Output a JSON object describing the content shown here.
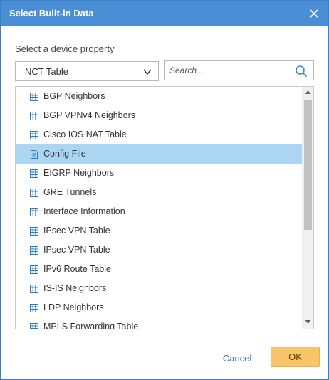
{
  "window": {
    "title": "Select Built-in Data"
  },
  "form": {
    "prompt": "Select a device property",
    "property_select": {
      "value": "NCT Table"
    },
    "search": {
      "placeholder": "Search...",
      "value": ""
    }
  },
  "list": {
    "items": [
      {
        "label": "BGP Neighbors",
        "icon": "table-icon",
        "selected": false
      },
      {
        "label": "BGP VPNv4 Neighbors",
        "icon": "table-icon",
        "selected": false
      },
      {
        "label": "Cisco IOS NAT Table",
        "icon": "table-icon",
        "selected": false
      },
      {
        "label": "Config File",
        "icon": "file-icon",
        "selected": true
      },
      {
        "label": "EIGRP Neighbors",
        "icon": "table-icon",
        "selected": false
      },
      {
        "label": "GRE Tunnels",
        "icon": "table-icon",
        "selected": false
      },
      {
        "label": "Interface Information",
        "icon": "table-icon",
        "selected": false
      },
      {
        "label": "IPsec VPN Table",
        "icon": "table-icon",
        "selected": false
      },
      {
        "label": "IPsec VPN Table",
        "icon": "table-icon",
        "selected": false
      },
      {
        "label": "IPv6 Route Table",
        "icon": "table-icon",
        "selected": false
      },
      {
        "label": "IS-IS Neighbors",
        "icon": "table-icon",
        "selected": false
      },
      {
        "label": "LDP Neighbors",
        "icon": "table-icon",
        "selected": false
      },
      {
        "label": "MPLS Forwarding Table",
        "icon": "table-icon",
        "selected": false
      }
    ]
  },
  "footer": {
    "cancel_label": "Cancel",
    "ok_label": "OK"
  },
  "colors": {
    "titlebar": "#4a8fd6",
    "selection": "#aad6f3",
    "icon": "#2f7bc2",
    "ok_button": "#f8c56a",
    "cancel_text": "#2f7bc2"
  }
}
